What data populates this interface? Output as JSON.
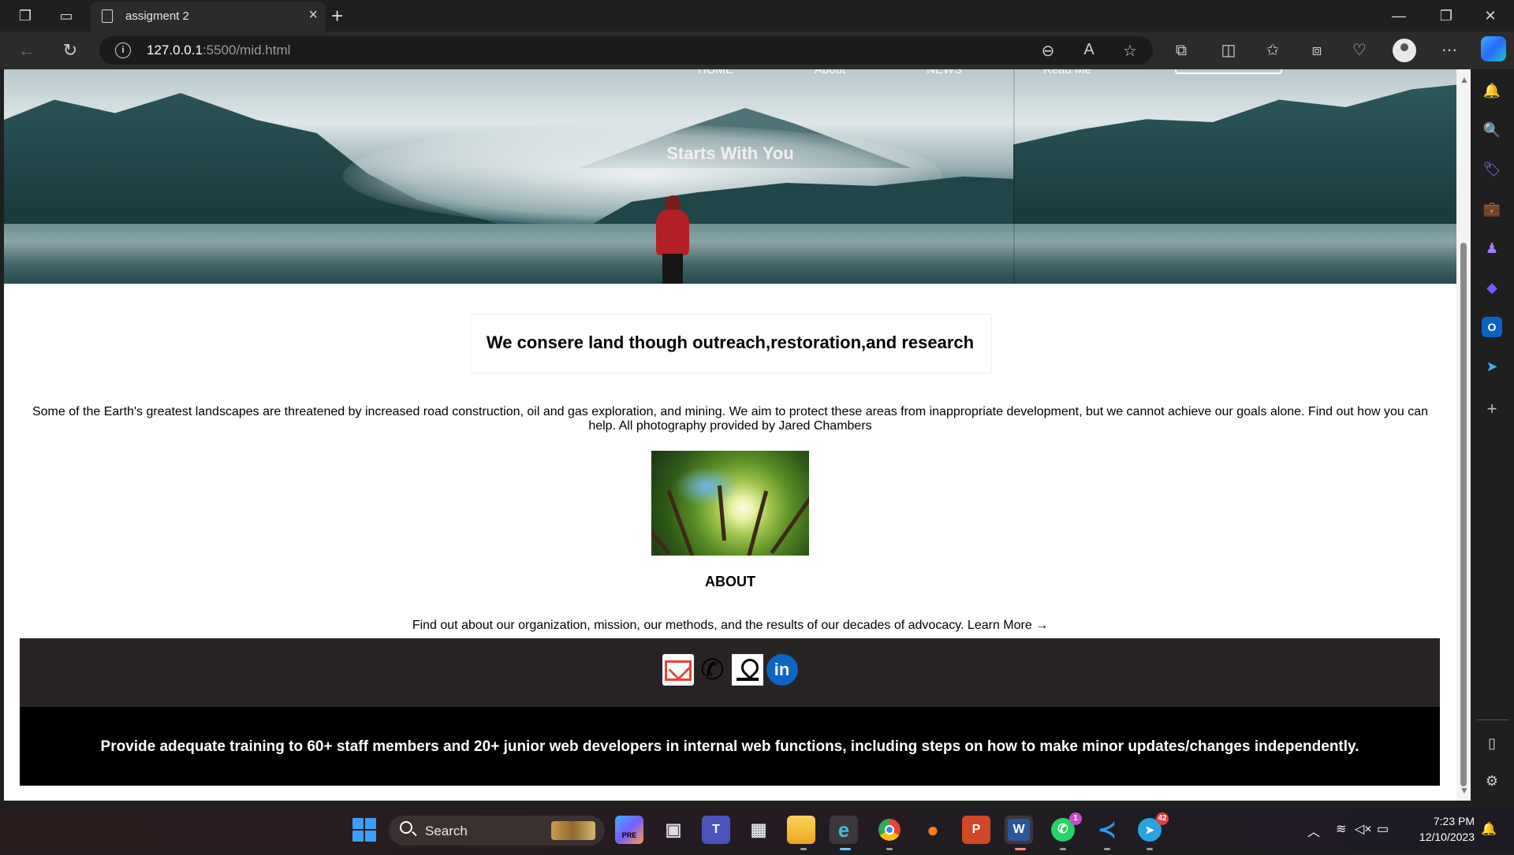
{
  "browser": {
    "tab_title": "assigment 2",
    "url_host": "127.0.0.1",
    "url_rest": ":5500/mid.html"
  },
  "page": {
    "nav": [
      "HOME",
      "About",
      "NEWS",
      "Read Me"
    ],
    "hero_title": "Starts With You",
    "headline": "We consere land though outreach,restoration,and research",
    "intro": "Some of the Earth's greatest landscapes are threatened by increased road construction, oil and gas exploration, and mining. We aim to protect these areas from inappropriate development, but we cannot achieve our goals alone. Find out how you can help. All photography provided by Jared Chambers",
    "about_heading": "ABOUT",
    "mission": "Find out about our organization, mission, our methods, and the results of our decades of advocacy. Learn More →",
    "socials": [
      "gmail-icon",
      "phone-icon",
      "maps-icon",
      "linkedin-icon"
    ],
    "linkedin_text": "in",
    "footer_text": "Provide adequate training to 60+ staff members and 20+ junior web developers in internal web functions, including steps on how to make minor updates/changes independently."
  },
  "taskbar": {
    "search_label": "Search",
    "apps": [
      {
        "name": "copilot-pre",
        "badge": ""
      },
      {
        "name": "task-view",
        "badge": ""
      },
      {
        "name": "teams",
        "badge": ""
      },
      {
        "name": "microsoft-store",
        "badge": ""
      },
      {
        "name": "file-explorer",
        "badge": ""
      },
      {
        "name": "edge",
        "badge": ""
      },
      {
        "name": "chrome",
        "badge": ""
      },
      {
        "name": "firefox",
        "badge": ""
      },
      {
        "name": "powerpoint",
        "badge": ""
      },
      {
        "name": "word",
        "badge": ""
      },
      {
        "name": "whatsapp",
        "badge": "1"
      },
      {
        "name": "vscode",
        "badge": ""
      },
      {
        "name": "telegram",
        "badge": "42"
      }
    ],
    "time": "7:23 PM",
    "date": "12/10/2023"
  },
  "colors": {
    "footer_top": "#282424",
    "footer_bottom": "#000000",
    "linkedin": "#0a66c2",
    "gmail": "#ea4335"
  }
}
